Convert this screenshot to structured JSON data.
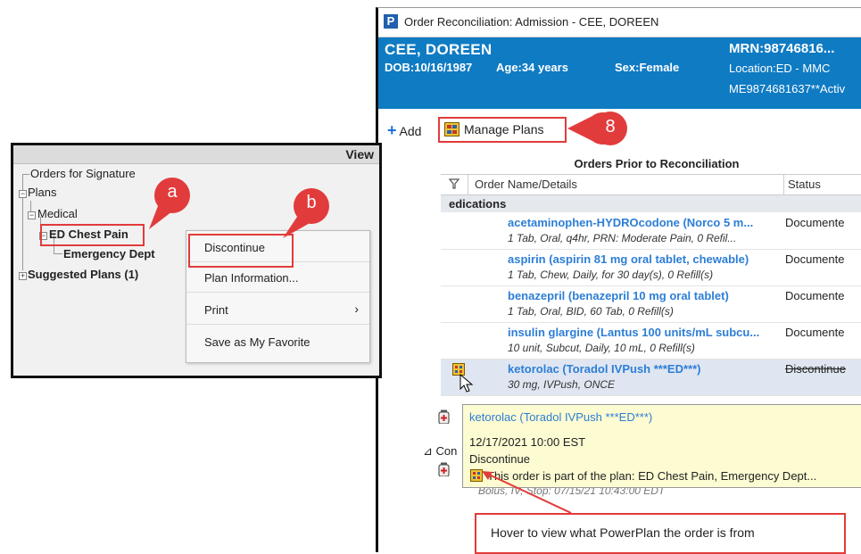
{
  "window": {
    "app_letter": "P",
    "title": "Order Reconciliation: Admission - CEE, DOREEN"
  },
  "patient": {
    "name": "CEE, DOREEN",
    "dob": "DOB:10/16/1987",
    "age": "Age:34 years",
    "sex": "Sex:Female",
    "mrn": "MRN:98746816...",
    "location": "Location:ED - MMC",
    "fin": "ME9874681637**Activ"
  },
  "toolbar": {
    "add_label": "Add",
    "manage_plans_label": "Manage Plans"
  },
  "orders_table": {
    "header": "Orders Prior to Reconciliation",
    "columns": [
      "Order Name/Details",
      "Status"
    ],
    "section_label": "edications",
    "orders": [
      {
        "name": "acetaminophen-HYDROcodone (Norco 5 m...",
        "details": "1 Tab, Oral, q4hr, PRN: Moderate Pain, 0 Refil...",
        "status": "Documente"
      },
      {
        "name": "aspirin (aspirin 81 mg oral tablet, chewable)",
        "details": "1 Tab, Chew, Daily, for 30 day(s), 0 Refill(s)",
        "status": "Documente"
      },
      {
        "name": "benazepril (benazepril 10 mg oral tablet)",
        "details": "1 Tab, Oral, BID, 60 Tab, 0 Refill(s)",
        "status": "Documente"
      },
      {
        "name": "insulin glargine (Lantus 100 units/mL subcu...",
        "details": "10 unit, Subcut, Daily, 10 mL, 0 Refill(s)",
        "status": "Documente"
      },
      {
        "name": "ketorolac (Toradol IVPush ***ED***)",
        "details": "30 mg, IVPush, ONCE",
        "status": "Discontinue"
      }
    ],
    "continuous_label": "Con",
    "continuous_detail": "Bolus, IV, Stop: 07/15/21 10:43:00 EDT"
  },
  "tooltip": {
    "order_name": "ketorolac (Toradol IVPush ***ED***)",
    "datetime": "12/17/2021 10:00 EST",
    "action": "Discontinue",
    "plan_note": "This order is part of the plan: ED Chest Pain, Emergency Dept..."
  },
  "hover_note": "Hover to view what PowerPlan the order is from",
  "left_panel": {
    "header": "View",
    "tree": {
      "orders_for_signature": "Orders for Signature",
      "plans": "Plans",
      "medical": "Medical",
      "ed_chest_pain": "ED Chest Pain",
      "emergency_dept": "Emergency Dept",
      "suggested_plans": "Suggested Plans (1)"
    },
    "context_menu": {
      "discontinue": "Discontinue",
      "plan_information": "Plan Information...",
      "print": "Print",
      "save_favorite": "Save as My Favorite"
    }
  },
  "callouts": {
    "a": "a",
    "b": "b",
    "eight": "8"
  },
  "colors": {
    "banner": "#0f7bc3",
    "highlight": "#e23b3b",
    "order_link": "#2d7ed6",
    "tooltip_bg": "#fdfbd2"
  }
}
